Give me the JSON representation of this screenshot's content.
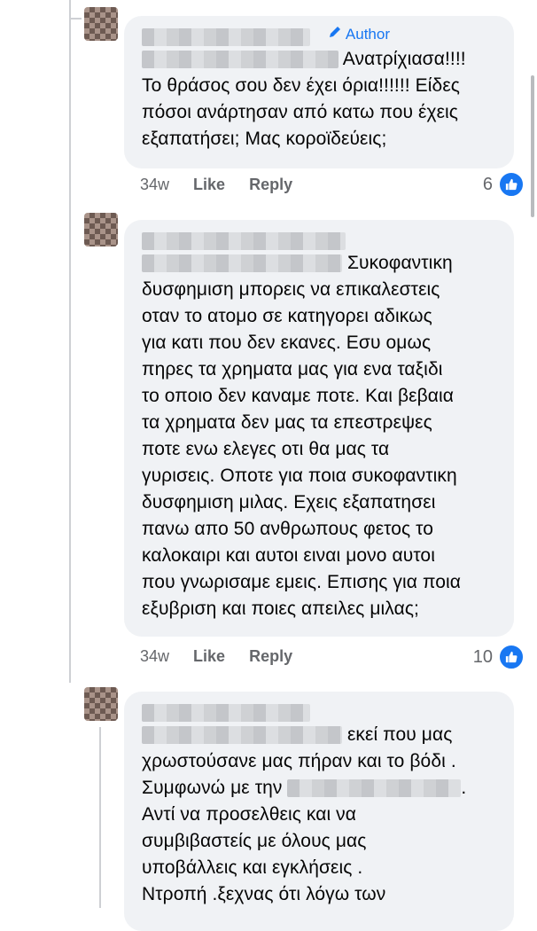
{
  "comments": [
    {
      "author_label": "Author",
      "text_inline": "Ανατρίχιασα!!!!",
      "text_lines": [
        "Το θράσος σου δεν έχει όρια!!!!!! Είδες",
        "πόσοι ανάρτησαν από κατω που έχεις",
        "εξαπατήσει; Μας κοροϊδεύεις;"
      ],
      "time": "34w",
      "like": "Like",
      "reply": "Reply",
      "reaction_count": "6"
    },
    {
      "text_inline": "Συκοφαντικη",
      "text_lines": [
        "δυσφημιση μπορεις να επικαλεστεις",
        "οταν το ατομο σε κατηγορει αδικως",
        "για κατι που δεν εκανες. Εσυ ομως",
        "πηρες τα χρηματα μας για ενα ταξιδι",
        "το οποιο δεν καναμε ποτε. Και βεβαια",
        "τα χρηματα δεν μας τα επεστρεψες",
        "ποτε ενω ελεγες οτι θα μας τα",
        "γυρισεις. Οποτε για ποια συκοφαντικη",
        "δυσφημιση μιλας. Εχεις εξαπατησει",
        "πανω απο 50 ανθρωπους φετος το",
        "καλοκαιρι και αυτοι ειναι μονο αυτοι",
        "που γνωρισαμε εμεις. Επισης για ποια",
        "εξυβριση και ποιες απειλες μιλας;"
      ],
      "time": "34w",
      "like": "Like",
      "reply": "Reply",
      "reaction_count": "10"
    },
    {
      "text_inline": "εκεί που  μας",
      "line2": "χρωστούσανε μας πήραν και το βόδι .",
      "line3_prefix": "Συμφωνώ με την",
      "line3_suffix": ".",
      "text_lines": [
        "Αντί να προσελθεις και να",
        "συμβιβαστείς με όλους μας",
        "υποβάλλεις και εγκλήσεις  .",
        "Ντροπή .ξεχνας ότι λόγω των"
      ]
    }
  ]
}
